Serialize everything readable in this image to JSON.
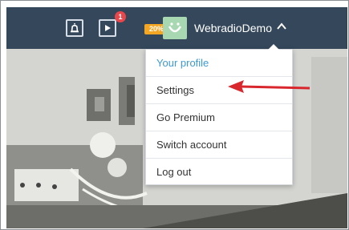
{
  "header": {
    "notification_count": "1",
    "premium_badge": "20%",
    "username": "WebradioDemo"
  },
  "icons": {
    "bell": "bell-icon",
    "player": "play-box-icon",
    "caret": "caret-up-icon",
    "avatar": "avatar-icon"
  },
  "menu": {
    "items": [
      {
        "label": "Your profile"
      },
      {
        "label": "Settings"
      },
      {
        "label": "Go Premium"
      },
      {
        "label": "Switch account"
      },
      {
        "label": "Log out"
      }
    ]
  },
  "colors": {
    "topbar": "#34475b",
    "accent": "#3d9ad1",
    "badge": "#e8474b",
    "premium": "#f5a623",
    "annotation_arrow": "#d9272e"
  }
}
